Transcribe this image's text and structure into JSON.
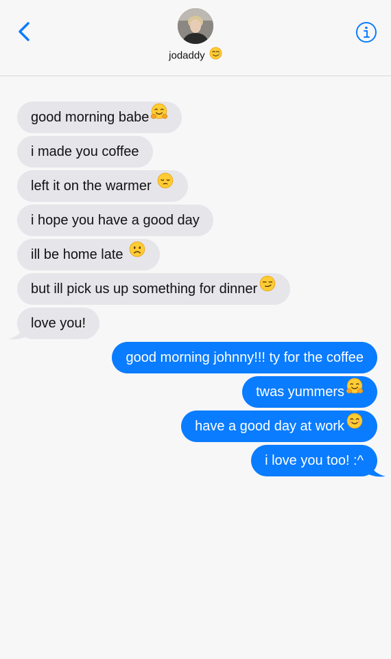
{
  "header": {
    "contact_name": "jodaddy",
    "contact_emoji": "smiling-face-with-tear-emoji"
  },
  "colors": {
    "incoming_bubble": "#e5e5ea",
    "outgoing_bubble": "#0a7cff",
    "accent": "#0a7cff",
    "background": "#f7f7f7"
  },
  "messages": [
    {
      "dir": "in",
      "text": "good morning babe",
      "emoji": "hugging-face-emoji"
    },
    {
      "dir": "in",
      "text": "i made you coffee",
      "emoji": ""
    },
    {
      "dir": "in",
      "text": "left it on the warmer ",
      "emoji": "pensive-face-emoji"
    },
    {
      "dir": "in",
      "text": "i hope you have a good day",
      "emoji": ""
    },
    {
      "dir": "in",
      "text": "ill be home late ",
      "emoji": "slightly-frowning-face-emoji"
    },
    {
      "dir": "in",
      "text": "but ill pick us up something for dinner",
      "emoji": "smirking-face-emoji"
    },
    {
      "dir": "in",
      "text": "love you!",
      "emoji": ""
    },
    {
      "dir": "out",
      "text": "good morning johnny!!! ty for the coffee",
      "emoji": ""
    },
    {
      "dir": "out",
      "text": "twas yummers",
      "emoji": "hugging-face-emoji"
    },
    {
      "dir": "out",
      "text": "have a good day at work",
      "emoji": "smiling-face-emoji"
    },
    {
      "dir": "out",
      "text": "i love you too! :^",
      "emoji": ""
    }
  ]
}
